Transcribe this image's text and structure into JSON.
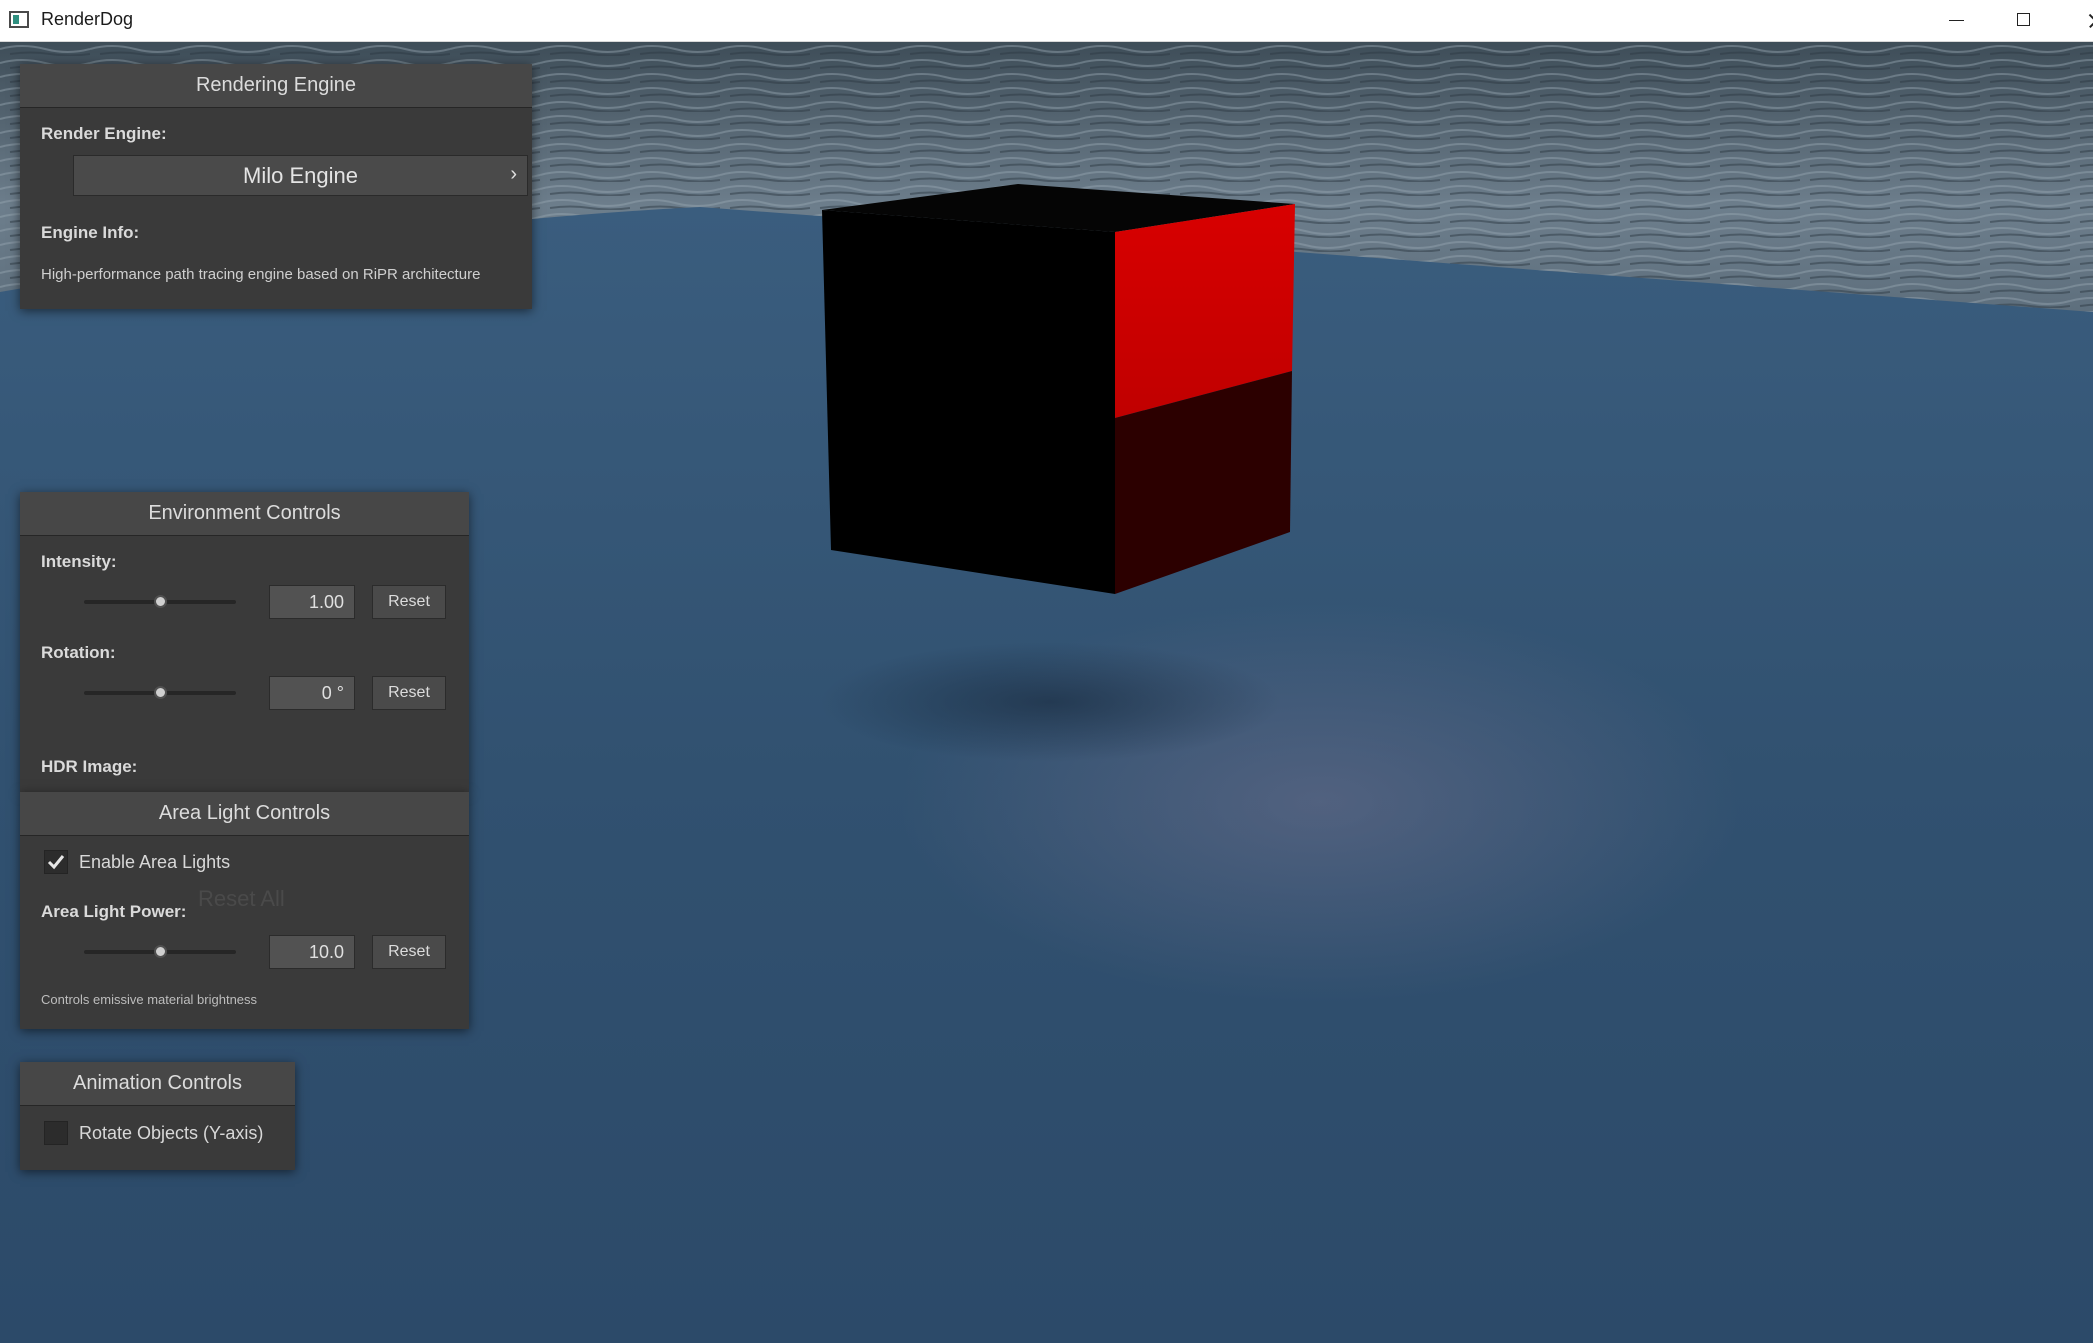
{
  "window": {
    "title": "RenderDog"
  },
  "scene": {
    "cube_front_color": "#000000",
    "cube_side_lit_color": "#d10000",
    "cube_side_dark_color": "#2c0000",
    "floor_color": "#304f6e",
    "sky_color": "#5a6c7b"
  },
  "rendering_engine": {
    "title": "Rendering Engine",
    "render_engine_label": "Render Engine:",
    "selected_engine": "Milo Engine",
    "engine_info_label": "Engine Info:",
    "engine_info_text": "High-performance path tracing engine based on RiPR architecture"
  },
  "environment_controls": {
    "title": "Environment Controls",
    "intensity_label": "Intensity:",
    "intensity_value": "1.00",
    "intensity_level": 0.5,
    "rotation_label": "Rotation:",
    "rotation_value": "0 °",
    "rotation_level": 0.5,
    "reset_label": "Reset",
    "hdr_label": "HDR Image:",
    "reset_all_label": "Reset All"
  },
  "area_light_controls": {
    "title": "Area Light Controls",
    "enable_label": "Enable Area Lights",
    "enabled": true,
    "power_label": "Area Light Power:",
    "power_value": "10.0",
    "power_level": 0.5,
    "reset_label": "Reset",
    "hint": "Controls emissive material brightness"
  },
  "animation_controls": {
    "title": "Animation Controls",
    "rotate_label": "Rotate Objects (Y-axis)",
    "rotate_enabled": false
  }
}
